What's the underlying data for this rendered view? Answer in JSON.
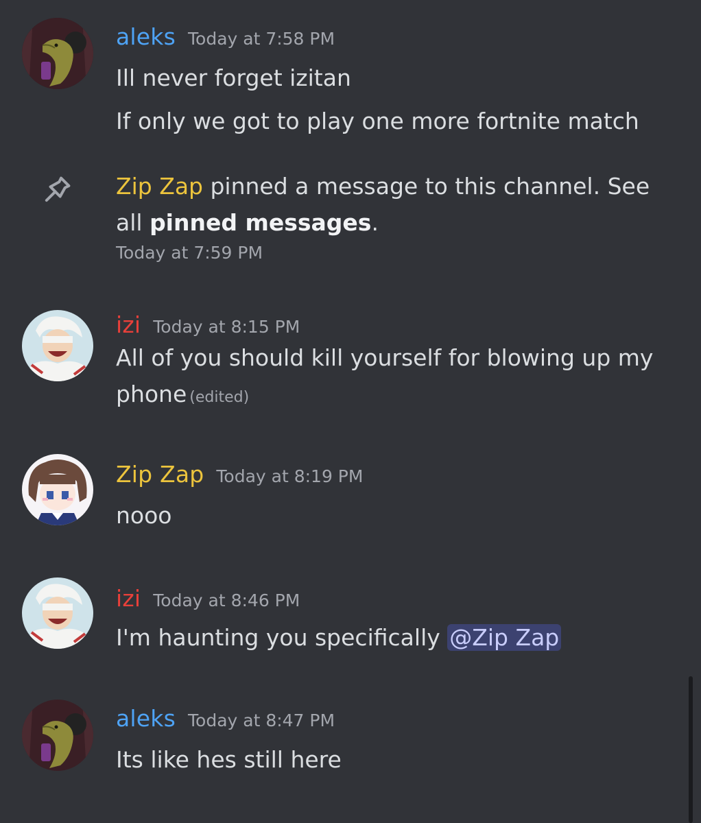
{
  "messages": [
    {
      "author": "aleks",
      "timestamp": "Today at 7:58 PM",
      "lines": [
        "Ill never forget izitan",
        "If only we got to play one more fortnite match"
      ]
    },
    {
      "system": {
        "actor": "Zip Zap",
        "text_1": " pinned a message to this channel. See",
        "text_2_prefix": "all ",
        "link": "pinned messages",
        "text_2_suffix": ".",
        "timestamp": "Today at 7:59 PM",
        "icon": "pin-icon"
      }
    },
    {
      "author": "izi",
      "timestamp": "Today at 8:15 PM",
      "lines": [
        "All of you should kill yourself for blowing up my",
        "phone"
      ],
      "edited": "(edited)"
    },
    {
      "author": "Zip Zap",
      "timestamp": "Today at 8:19 PM",
      "lines": [
        "nooo"
      ]
    },
    {
      "author": "izi",
      "timestamp": "Today at 8:46 PM",
      "text": "I'm haunting you specifically ",
      "mention": "@Zip Zap"
    },
    {
      "author": "aleks",
      "timestamp": "Today at 8:47 PM",
      "lines": [
        "Its like hes still here"
      ]
    }
  ],
  "colors": {
    "background": "#313338",
    "aleks": "#4ea3f5",
    "izi": "#e8403a",
    "zip_zap": "#ecc43d",
    "timestamp": "#a3a6ad",
    "mention_bg": "#3c4270"
  }
}
